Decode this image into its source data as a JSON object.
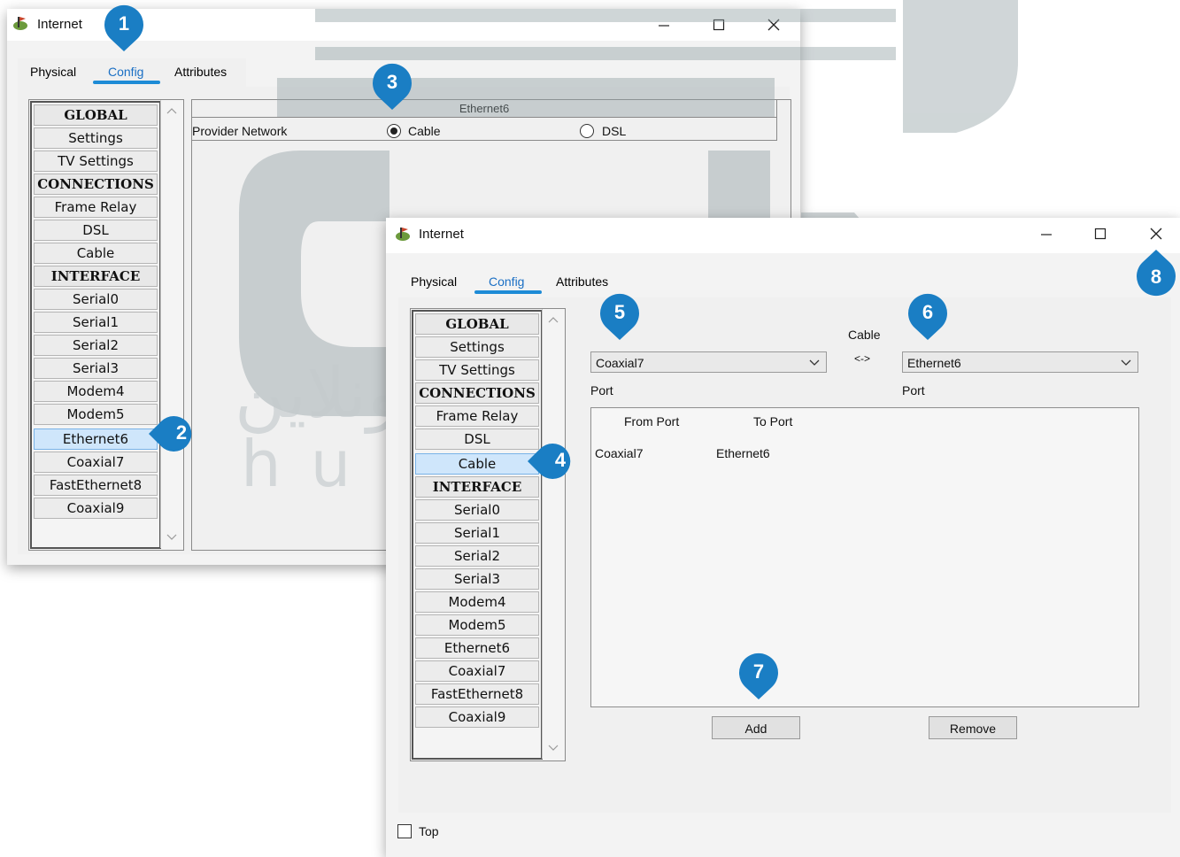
{
  "window1": {
    "title": "Internet",
    "tabs": [
      {
        "label": "Physical"
      },
      {
        "label": "Config"
      },
      {
        "label": "Attributes"
      }
    ],
    "list": [
      "GLOBAL",
      "Settings",
      "TV Settings",
      "CONNECTIONS",
      "Frame Relay",
      "DSL",
      "Cable",
      "INTERFACE",
      "Serial0",
      "Serial1",
      "Serial2",
      "Serial3",
      "Modem4",
      "Modem5",
      "Ethernet6",
      "Coaxial7",
      "FastEthernet8",
      "Coaxial9"
    ],
    "panel_title": "Ethernet6",
    "provider_label": "Provider Network",
    "radio_cable": "Cable",
    "radio_dsl": "DSL",
    "selected_radio": "Cable"
  },
  "window2": {
    "title": "Internet",
    "tabs": [
      {
        "label": "Physical"
      },
      {
        "label": "Config"
      },
      {
        "label": "Attributes"
      }
    ],
    "list": [
      "GLOBAL",
      "Settings",
      "TV Settings",
      "CONNECTIONS",
      "Frame Relay",
      "DSL",
      "Cable",
      "INTERFACE",
      "Serial0",
      "Serial1",
      "Serial2",
      "Serial3",
      "Modem4",
      "Modem5",
      "Ethernet6",
      "Coaxial7",
      "FastEthernet8",
      "Coaxial9"
    ],
    "cable_label": "Cable",
    "arrow_label": "<->",
    "left_combo": "Coaxial7",
    "right_combo": "Ethernet6",
    "left_port_label": "Port",
    "right_port_label": "Port",
    "table": {
      "headers": [
        "From Port",
        "To Port"
      ],
      "rows": [
        [
          "Coaxial7",
          "Ethernet6"
        ]
      ]
    },
    "add_button": "Add",
    "remove_button": "Remove",
    "top_checkbox": "Top"
  },
  "badges": {
    "b1": "1",
    "b2": "2",
    "b3": "3",
    "b4": "4",
    "b5": "5",
    "b6": "6",
    "b7": "7",
    "b8": "8"
  },
  "watermark": {
    "arabic": "الحلول أونلاين",
    "latin": "hulul online"
  },
  "colors": {
    "badge": "#1a7ec4",
    "watermark": "#a9b4b7",
    "selected_item": "#cfe6fb",
    "tab_underline": "#1d8bd6"
  }
}
